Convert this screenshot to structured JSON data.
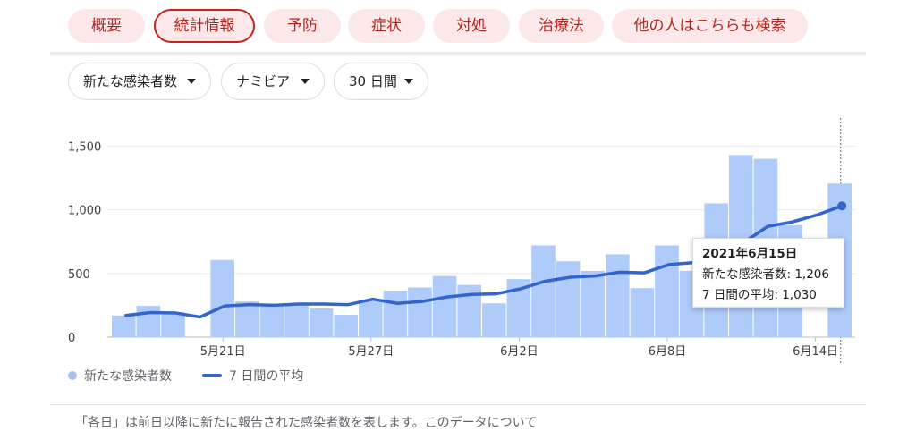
{
  "tabs": [
    {
      "label": "概要",
      "active": false
    },
    {
      "label": "統計情報",
      "active": true
    },
    {
      "label": "予防",
      "active": false
    },
    {
      "label": "症状",
      "active": false
    },
    {
      "label": "対処",
      "active": false
    },
    {
      "label": "治療法",
      "active": false
    },
    {
      "label": "他の人はこちらも検索",
      "active": false
    }
  ],
  "filters": {
    "metric": "新たな感染者数",
    "country": "ナミビア",
    "period": "30 日間"
  },
  "chart_data": {
    "type": "bar",
    "categories": [
      "5/17",
      "5/18",
      "5/19",
      "5/20",
      "5/21",
      "5/22",
      "5/23",
      "5/24",
      "5/25",
      "5/26",
      "5/27",
      "5/28",
      "5/29",
      "5/30",
      "5/31",
      "6/1",
      "6/2",
      "6/3",
      "6/4",
      "6/5",
      "6/6",
      "6/7",
      "6/8",
      "6/9",
      "6/10",
      "6/11",
      "6/12",
      "6/13",
      "6/14",
      "6/15"
    ],
    "x_tick_labels": [
      {
        "index": 4,
        "label": "5月21日"
      },
      {
        "index": 10,
        "label": "5月27日"
      },
      {
        "index": 16,
        "label": "6月2日"
      },
      {
        "index": 22,
        "label": "6月8日"
      },
      {
        "index": 28,
        "label": "6月14日"
      }
    ],
    "y_ticks": [
      {
        "value": 0,
        "label": "0"
      },
      {
        "value": 500,
        "label": "500"
      },
      {
        "value": 1000,
        "label": "1,000"
      },
      {
        "value": 1500,
        "label": "1,500"
      }
    ],
    "ylim": [
      0,
      1650
    ],
    "grid": true,
    "series": [
      {
        "name": "新たな感染者数",
        "type": "bar",
        "color": "#aecbfa",
        "values": [
          170,
          245,
          195,
          0,
          605,
          280,
          260,
          255,
          225,
          175,
          285,
          365,
          390,
          480,
          410,
          265,
          455,
          720,
          595,
          520,
          650,
          385,
          720,
          520,
          1050,
          1430,
          1400,
          880,
          0,
          1206
        ]
      },
      {
        "name": "7 日間の平均",
        "type": "line",
        "color": "#3366cc",
        "values": [
          170,
          193,
          190,
          158,
          245,
          255,
          250,
          260,
          260,
          255,
          298,
          265,
          280,
          315,
          335,
          340,
          380,
          440,
          470,
          480,
          510,
          505,
          570,
          585,
          650,
          740,
          870,
          905,
          960,
          1030
        ]
      }
    ]
  },
  "tooltip": {
    "date": "2021年6月15日",
    "line1": "新たな感染者数: 1,206",
    "line2": "7 日間の平均: 1,030"
  },
  "legend": {
    "bars": "新たな感染者数",
    "line": "7 日間の平均"
  },
  "footnote": "「各日」は前日以降に新たに報告された感染者数を表します。このデータについて"
}
